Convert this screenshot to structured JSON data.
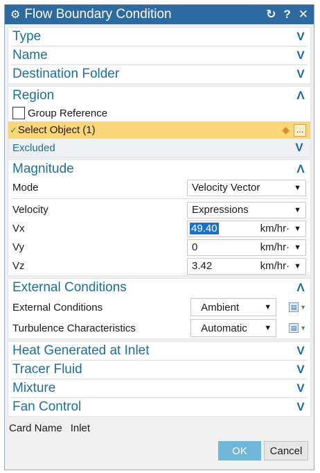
{
  "window": {
    "title": "Flow Boundary Condition",
    "reset_icon": "reset-icon",
    "help_label": "?",
    "close_label": "✕"
  },
  "sections": {
    "type": "Type",
    "name": "Name",
    "destination": "Destination Folder",
    "region": "Region",
    "magnitude": "Magnitude",
    "external": "External Conditions",
    "heat": "Heat Generated at Inlet",
    "tracer": "Tracer Fluid",
    "mixture": "Mixture",
    "fan": "Fan Control"
  },
  "region": {
    "group_reference": "Group Reference",
    "select_object": "Select Object (1)",
    "excluded": "Excluded"
  },
  "magnitude": {
    "mode_label": "Mode",
    "mode_value": "Velocity Vector",
    "velocity_label": "Velocity",
    "velocity_value": "Expressions",
    "vx_label": "Vx",
    "vx_value": "49.40",
    "vx_unit": "km/hr·",
    "vy_label": "Vy",
    "vy_value": "0",
    "vy_unit": "km/hr·",
    "vz_label": "Vz",
    "vz_value": "3.42",
    "vz_unit": "km/hr·"
  },
  "external": {
    "ext_label": "External Conditions",
    "ext_value": "Ambient",
    "turb_label": "Turbulence Characteristics",
    "turb_value": "Automatic"
  },
  "card": {
    "label": "Card Name",
    "value": "Inlet"
  },
  "buttons": {
    "ok": "OK",
    "cancel": "Cancel"
  },
  "colors": {
    "title_bar": "#2d6a9f",
    "section_text": "#1d6e9c",
    "selection_row": "#fbd57a",
    "ok_button": "#6fb6d9"
  }
}
